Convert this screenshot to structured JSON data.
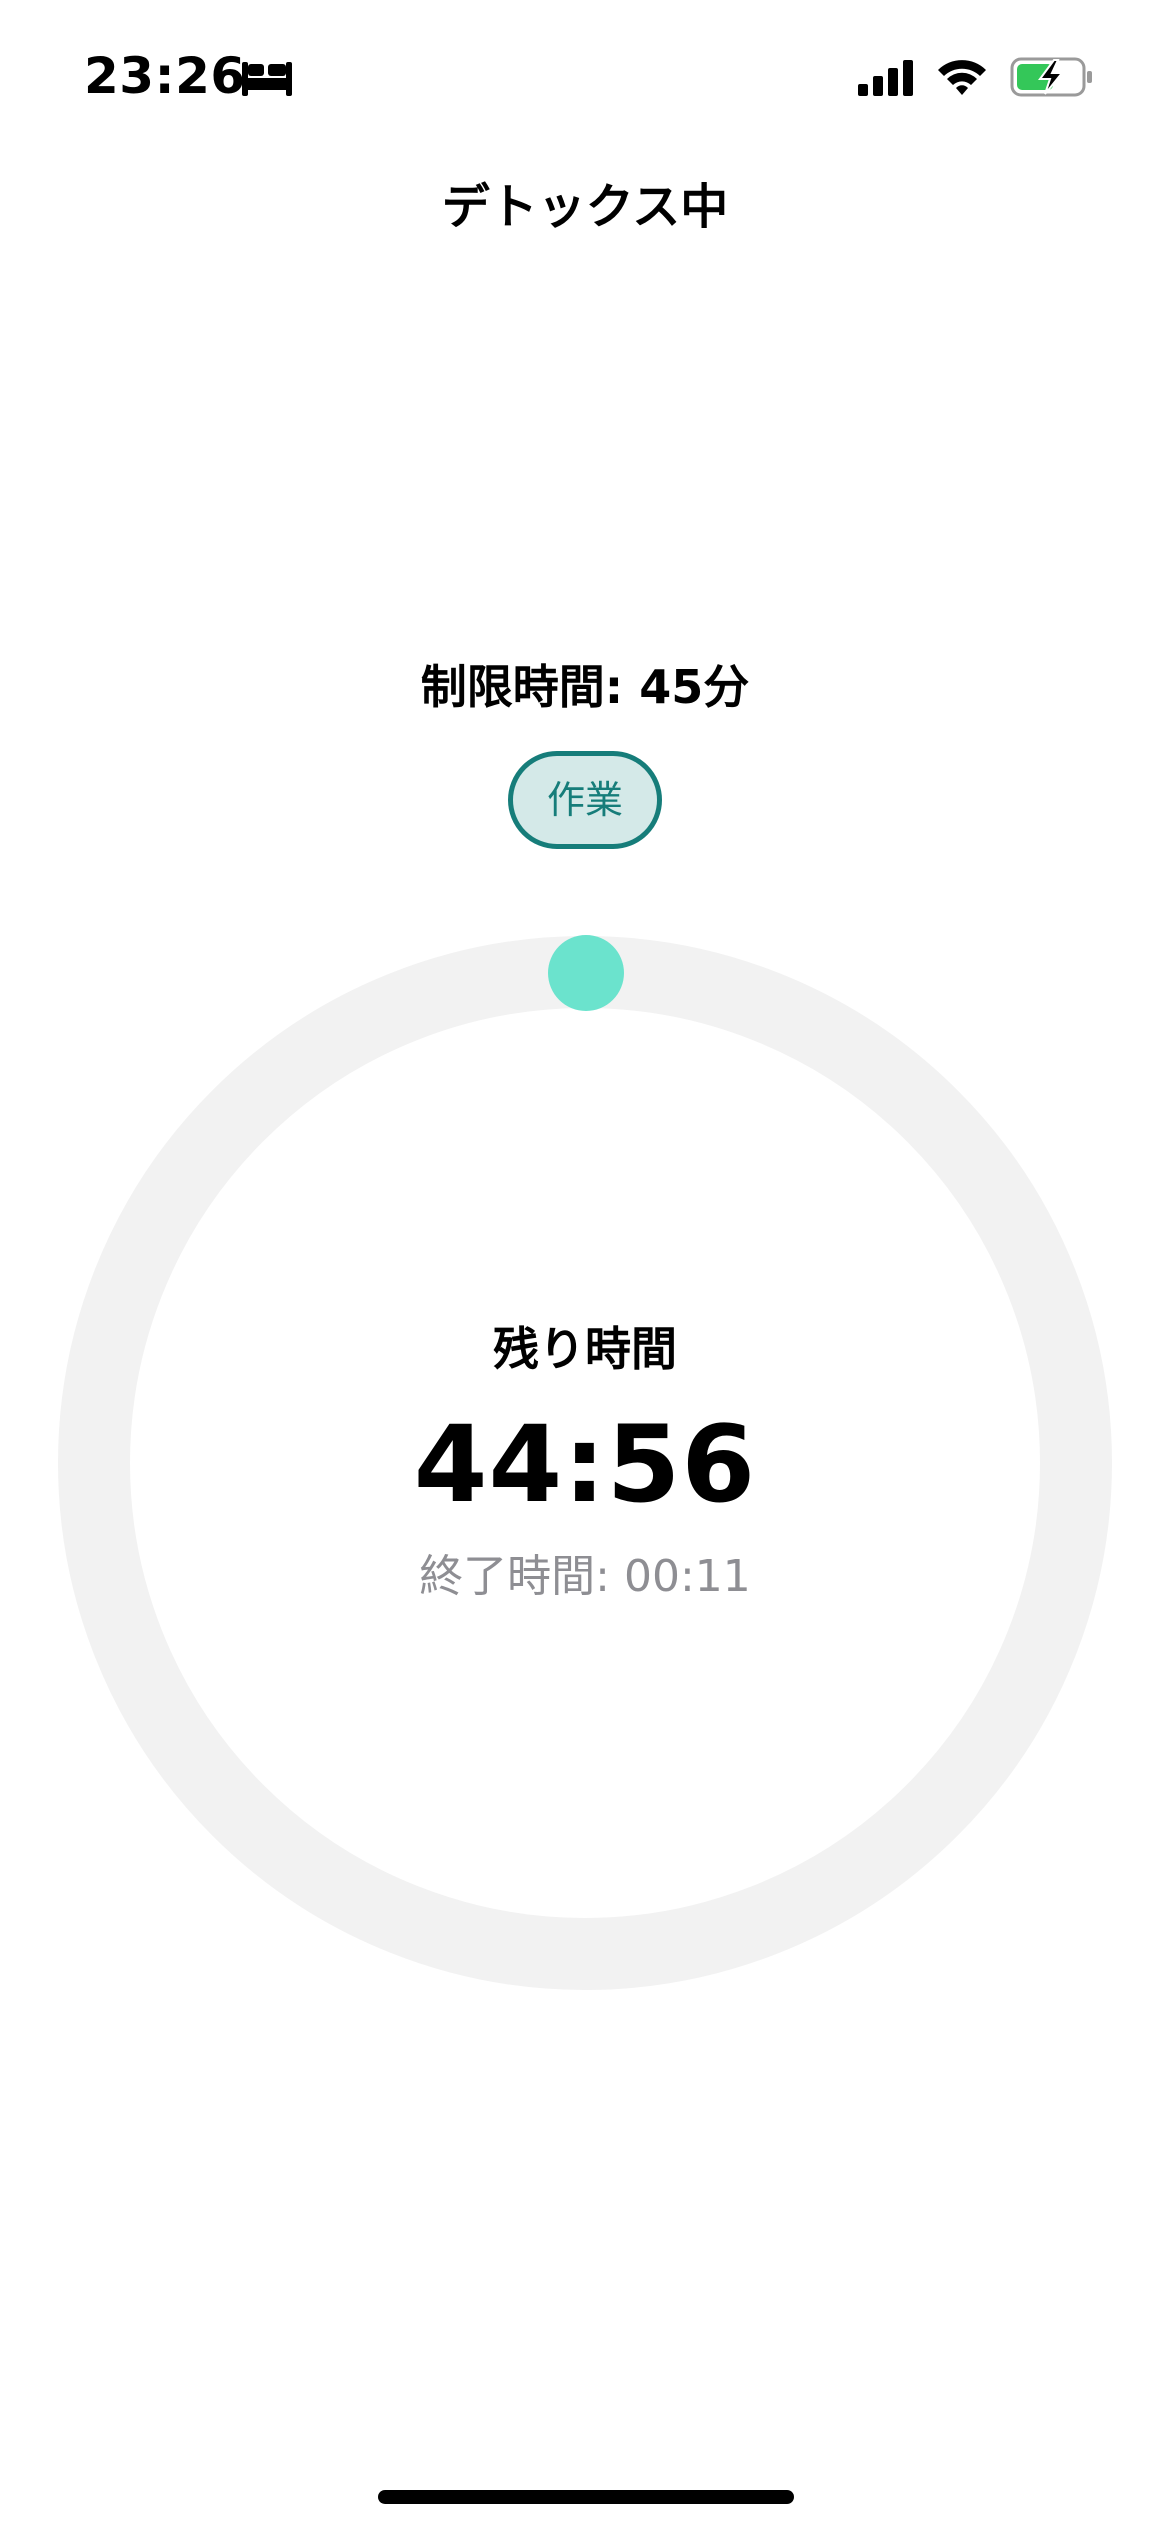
{
  "status_bar": {
    "time": "23:26",
    "focus_icon": "bed-icon",
    "signal_icon": "cellular-signal-icon",
    "wifi_icon": "wifi-icon",
    "battery_icon": "battery-charging-icon",
    "battery_color": "#34c759"
  },
  "header": {
    "title": "デトックス中"
  },
  "session": {
    "limit_label": "制限時間: 45分",
    "category": "作業",
    "category_color": "#167d7a",
    "category_bg": "#d4e9e8"
  },
  "timer": {
    "remaining_label": "残り時間",
    "remaining_time": "44:56",
    "end_time_label": "終了時間: 00:11",
    "progress_fraction": 0.0,
    "ring_track_color": "#f2f2f2",
    "handle_color": "#6be3cd"
  }
}
